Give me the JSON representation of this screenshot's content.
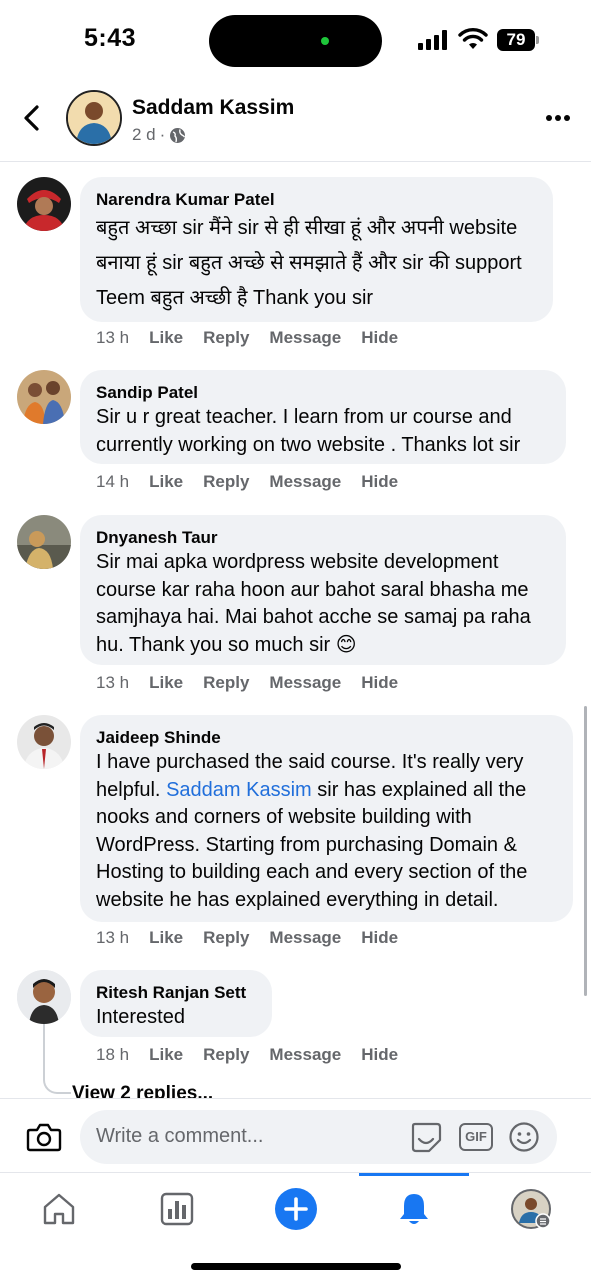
{
  "status": {
    "time": "5:43",
    "battery": "79"
  },
  "post": {
    "author": "Saddam Kassim",
    "age": "2 d",
    "separator": "·"
  },
  "comments": [
    {
      "author": "Narendra Kumar Patel",
      "lines": [
        "बहुत अच्छा sir मैंने sir से ही सीखा हूं और अपनी website",
        "बनाया हूं sir बहुत अच्छे से समझाते हैं और sir की support",
        "Teem बहुत अच्छी है Thank you sir"
      ],
      "time": "13 h"
    },
    {
      "author": "Sandip Patel",
      "lines": [
        "Sir u r great teacher. I learn from ur course and",
        "currently working on two website . Thanks lot sir"
      ],
      "time": "14 h"
    },
    {
      "author": "Dnyanesh Taur",
      "lines": [
        "Sir mai apka wordpress website development",
        "course kar raha hoon aur bahot saral bhasha me",
        "samjhaya hai. Mai bahot acche se samaj pa raha",
        "hu. Thank you so much sir"
      ],
      "emoji": "😊",
      "time": "13 h"
    },
    {
      "author": "Jaideep Shinde",
      "line1": "I have purchased the said course. It's really very",
      "line2_before": "helpful. ",
      "mention": "Saddam Kassim",
      "line2_after": " sir has explained all the",
      "lines_rest": [
        "nooks and corners of website building with",
        "WordPress. Starting from purchasing Domain &",
        "Hosting to building each and every section of the",
        "website he has explained everything in detail."
      ],
      "time": "13 h"
    },
    {
      "author": "Ritesh Ranjan Sett",
      "lines": [
        "Interested"
      ],
      "time": "18 h"
    }
  ],
  "actions": {
    "like": "Like",
    "reply": "Reply",
    "message": "Message",
    "hide": "Hide"
  },
  "view_replies": "View 2 replies...",
  "composer": {
    "placeholder": "Write a comment...",
    "gif": "GIF"
  },
  "icons": [
    "back-arrow-icon",
    "globe-icon",
    "more-icon",
    "camera-icon",
    "sticker-icon",
    "gif-icon",
    "emoji-icon",
    "home-icon",
    "dashboard-icon",
    "create-icon",
    "notifications-icon",
    "profile-avatar"
  ],
  "colors": {
    "accent": "#1877f2",
    "mention": "#216fdb",
    "bubble": "#f0f2f5",
    "secondary_text": "#65676b"
  }
}
